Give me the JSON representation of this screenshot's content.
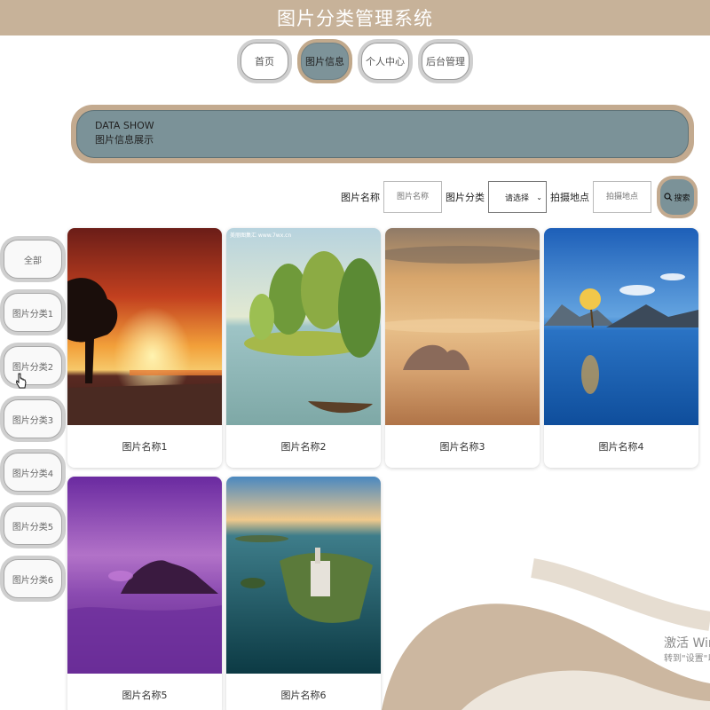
{
  "app": {
    "title": "图片分类管理系统"
  },
  "nav": {
    "items": [
      {
        "label": "首页",
        "active": false
      },
      {
        "label": "图片信息",
        "active": true
      },
      {
        "label": "个人中心",
        "active": false
      },
      {
        "label": "后台管理",
        "active": false
      }
    ]
  },
  "banner": {
    "line1": "DATA SHOW",
    "line2": "图片信息展示"
  },
  "search": {
    "name_label": "图片名称",
    "name_placeholder": "图片名称",
    "category_label": "图片分类",
    "category_selected": "请选择",
    "location_label": "拍摄地点",
    "location_placeholder": "拍摄地点",
    "button_label": "搜索"
  },
  "categories": [
    {
      "label": "全部"
    },
    {
      "label": "图片分类1"
    },
    {
      "label": "图片分类2"
    },
    {
      "label": "图片分类3"
    },
    {
      "label": "图片分类4"
    },
    {
      "label": "图片分类5"
    },
    {
      "label": "图片分类6"
    }
  ],
  "cards": [
    {
      "name": "图片名称1",
      "scene": "sunset-tree"
    },
    {
      "name": "图片名称2",
      "scene": "painted-lake-trees"
    },
    {
      "name": "图片名称3",
      "scene": "desert-clouds"
    },
    {
      "name": "图片名称4",
      "scene": "lake-tree-mountains"
    },
    {
      "name": "图片名称5",
      "scene": "purple-sea-island"
    },
    {
      "name": "图片名称6",
      "scene": "aerial-island-city"
    }
  ],
  "card2_watermark": "美丽图集汇  www.7wx.cn",
  "watermark": {
    "line1": "激活 Windo",
    "line2": "转到\"设置\"以激"
  },
  "colors": {
    "header": "#c7b299",
    "accent": "#7b9298",
    "accent_border": "#c3aa8f"
  }
}
